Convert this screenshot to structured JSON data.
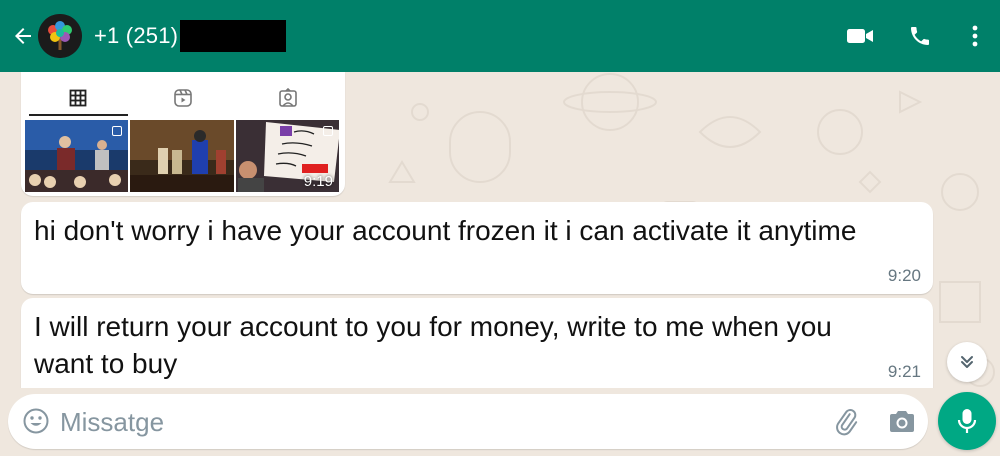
{
  "header": {
    "contact_name": "+1 (251)",
    "bg_color": "#008069"
  },
  "media_card": {
    "tabs": [
      {
        "icon": "grid-icon",
        "active": true
      },
      {
        "icon": "reels-icon",
        "active": false
      },
      {
        "icon": "tagged-icon",
        "active": false
      }
    ],
    "time": "9:19"
  },
  "messages": [
    {
      "text": "hi don't worry i have your account frozen it i can activate it anytime",
      "time": "9:20"
    },
    {
      "text": "I will return your account to you for money, write to me when you want to buy",
      "time": "9:21"
    }
  ],
  "composer": {
    "placeholder": "Missatge"
  },
  "colors": {
    "accent": "#00a884",
    "chat_bg": "#efe7de",
    "bubble_bg": "#ffffff",
    "time_text": "#667781"
  }
}
